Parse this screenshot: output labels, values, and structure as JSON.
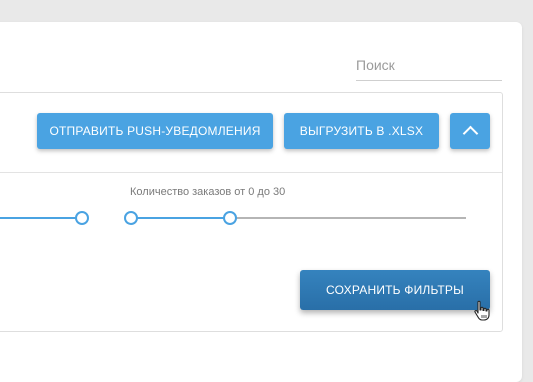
{
  "search": {
    "placeholder": "Поиск",
    "value": ""
  },
  "toolbar": {
    "push_label": "Отправить push-уведомления",
    "xlsx_label": "Выгрузить в .xlsx",
    "collapse_icon": "chevron-up-icon"
  },
  "filters": {
    "range_slider_1": {
      "label": "",
      "upper_handle_fraction": 1.0
    },
    "orders_slider": {
      "label": "Количество заказов от 0 до 30",
      "min": 0,
      "max": 30
    },
    "save_label": "Сохранить фильтры"
  },
  "colors": {
    "accent": "#4aa3e2",
    "save_button": "#2f78b0",
    "track_inactive": "#b5b5b5"
  }
}
